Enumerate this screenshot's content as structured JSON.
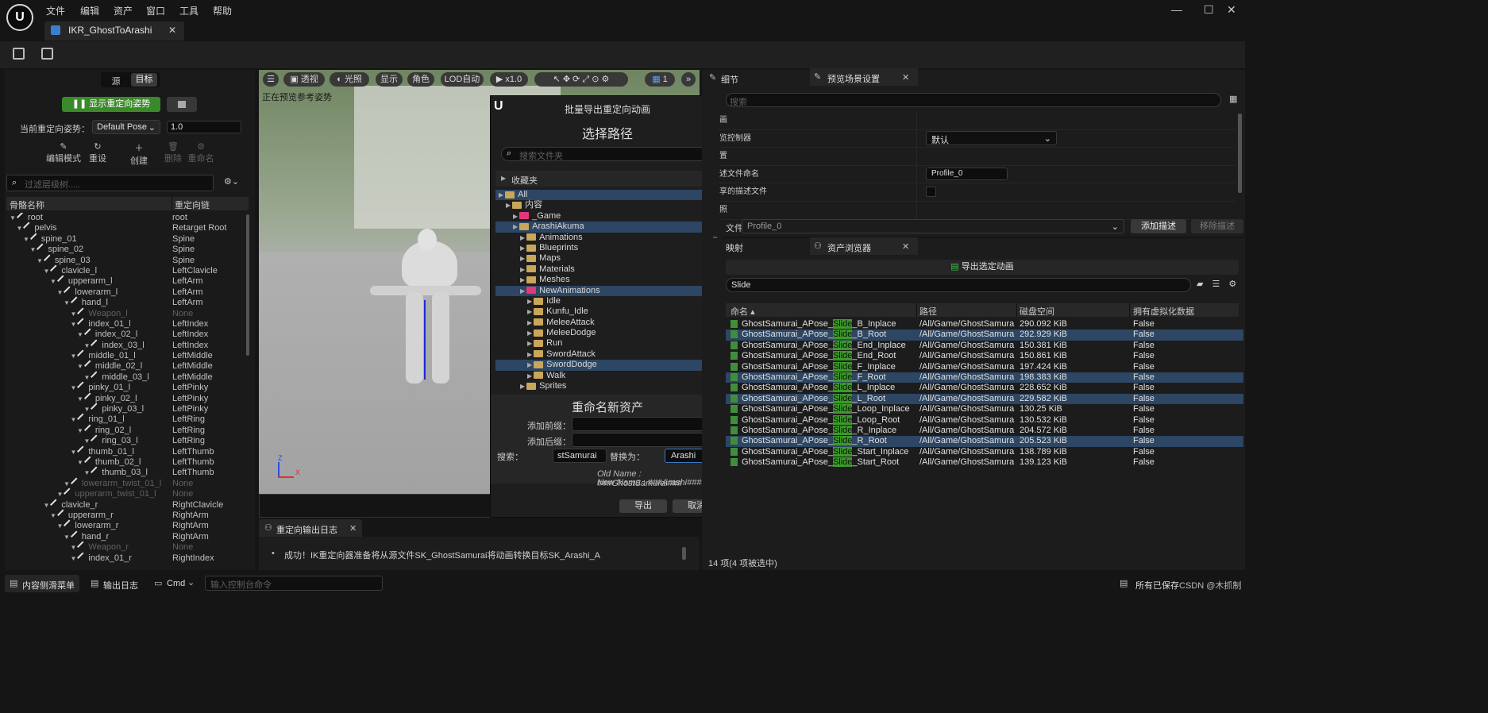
{
  "menu": [
    "文件",
    "编辑",
    "资产",
    "窗口",
    "工具",
    "帮助"
  ],
  "tab_title": "IKR_GhostToArashi",
  "left": {
    "toggle": [
      "源",
      "目标"
    ],
    "show_pose_btn": "显示重定向姿势",
    "current_pose_label": "当前重定向姿势：",
    "pose_value": "Default Pose",
    "pose_blend": "1.0",
    "tools": [
      "编辑模式",
      "重设",
      "创建",
      "删除",
      "重命名"
    ],
    "filter_placeholder": "过滤层级树.....",
    "columns": [
      "骨骼名称",
      "重定向链"
    ],
    "rows": [
      {
        "d": 0,
        "name": "root",
        "chain": "root",
        "dim": false
      },
      {
        "d": 1,
        "name": "pelvis",
        "chain": "Retarget Root",
        "dim": false
      },
      {
        "d": 2,
        "name": "spine_01",
        "chain": "Spine",
        "dim": false
      },
      {
        "d": 3,
        "name": "spine_02",
        "chain": "Spine",
        "dim": false
      },
      {
        "d": 4,
        "name": "spine_03",
        "chain": "Spine",
        "dim": false
      },
      {
        "d": 5,
        "name": "clavicle_l",
        "chain": "LeftClavicle",
        "dim": false
      },
      {
        "d": 6,
        "name": "upperarm_l",
        "chain": "LeftArm",
        "dim": false
      },
      {
        "d": 7,
        "name": "lowerarm_l",
        "chain": "LeftArm",
        "dim": false
      },
      {
        "d": 8,
        "name": "hand_l",
        "chain": "LeftArm",
        "dim": false
      },
      {
        "d": 9,
        "name": "Weapon_l",
        "chain": "None",
        "dim": true
      },
      {
        "d": 9,
        "name": "index_01_l",
        "chain": "LeftIndex",
        "dim": false
      },
      {
        "d": 10,
        "name": "index_02_l",
        "chain": "LeftIndex",
        "dim": false
      },
      {
        "d": 11,
        "name": "index_03_l",
        "chain": "LeftIndex",
        "dim": false
      },
      {
        "d": 9,
        "name": "middle_01_l",
        "chain": "LeftMiddle",
        "dim": false
      },
      {
        "d": 10,
        "name": "middle_02_l",
        "chain": "LeftMiddle",
        "dim": false
      },
      {
        "d": 11,
        "name": "middle_03_l",
        "chain": "LeftMiddle",
        "dim": false
      },
      {
        "d": 9,
        "name": "pinky_01_l",
        "chain": "LeftPinky",
        "dim": false
      },
      {
        "d": 10,
        "name": "pinky_02_l",
        "chain": "LeftPinky",
        "dim": false
      },
      {
        "d": 11,
        "name": "pinky_03_l",
        "chain": "LeftPinky",
        "dim": false
      },
      {
        "d": 9,
        "name": "ring_01_l",
        "chain": "LeftRing",
        "dim": false
      },
      {
        "d": 10,
        "name": "ring_02_l",
        "chain": "LeftRing",
        "dim": false
      },
      {
        "d": 11,
        "name": "ring_03_l",
        "chain": "LeftRing",
        "dim": false
      },
      {
        "d": 9,
        "name": "thumb_01_l",
        "chain": "LeftThumb",
        "dim": false
      },
      {
        "d": 10,
        "name": "thumb_02_l",
        "chain": "LeftThumb",
        "dim": false
      },
      {
        "d": 11,
        "name": "thumb_03_l",
        "chain": "LeftThumb",
        "dim": false
      },
      {
        "d": 8,
        "name": "lowerarm_twist_01_l",
        "chain": "None",
        "dim": true
      },
      {
        "d": 7,
        "name": "upperarm_twist_01_l",
        "chain": "None",
        "dim": true
      },
      {
        "d": 5,
        "name": "clavicle_r",
        "chain": "RightClavicle",
        "dim": false
      },
      {
        "d": 6,
        "name": "upperarm_r",
        "chain": "RightArm",
        "dim": false
      },
      {
        "d": 7,
        "name": "lowerarm_r",
        "chain": "RightArm",
        "dim": false
      },
      {
        "d": 8,
        "name": "hand_r",
        "chain": "RightArm",
        "dim": false
      },
      {
        "d": 9,
        "name": "Weapon_r",
        "chain": "None",
        "dim": true
      },
      {
        "d": 9,
        "name": "index_01_r",
        "chain": "RightIndex",
        "dim": false
      }
    ]
  },
  "viewport": {
    "buttons": [
      "透视",
      "光照",
      "显示",
      "角色",
      "LOD自动",
      "x1.0"
    ],
    "num": "1",
    "overlay": "正在预览参考姿势"
  },
  "log": {
    "tab": "重定向输出日志",
    "msg": "成功！IK重定向器准备将从源文件SK_GhostSamurai将动画转换目标SK_Arashi_A"
  },
  "dialog": {
    "title": "批量导出重定向动画",
    "heading": "选择路径",
    "search_placeholder": "搜索文件夹",
    "favorites": "收藏夹",
    "tree": [
      {
        "d": 0,
        "name": "All",
        "pink": false,
        "sel": true
      },
      {
        "d": 1,
        "name": "内容",
        "pink": false,
        "sel": false
      },
      {
        "d": 2,
        "name": "_Game",
        "pink": true,
        "sel": false
      },
      {
        "d": 2,
        "name": "ArashiAkuma",
        "pink": false,
        "sel": true
      },
      {
        "d": 3,
        "name": "Animations",
        "pink": false,
        "sel": false
      },
      {
        "d": 3,
        "name": "Blueprints",
        "pink": false,
        "sel": false
      },
      {
        "d": 3,
        "name": "Maps",
        "pink": false,
        "sel": false
      },
      {
        "d": 3,
        "name": "Materials",
        "pink": false,
        "sel": false
      },
      {
        "d": 3,
        "name": "Meshes",
        "pink": false,
        "sel": false
      },
      {
        "d": 3,
        "name": "NewAnimations",
        "pink": true,
        "sel": true
      },
      {
        "d": 4,
        "name": "Idle",
        "pink": false,
        "sel": false
      },
      {
        "d": 4,
        "name": "Kunfu_Idle",
        "pink": false,
        "sel": false
      },
      {
        "d": 4,
        "name": "MeleeAttack",
        "pink": false,
        "sel": false
      },
      {
        "d": 4,
        "name": "MeleeDodge",
        "pink": false,
        "sel": false
      },
      {
        "d": 4,
        "name": "Run",
        "pink": false,
        "sel": false
      },
      {
        "d": 4,
        "name": "SwordAttack",
        "pink": false,
        "sel": false
      },
      {
        "d": 4,
        "name": "SwordDodge",
        "pink": false,
        "sel": true
      },
      {
        "d": 4,
        "name": "Walk",
        "pink": false,
        "sel": false
      },
      {
        "d": 3,
        "name": "Sprites",
        "pink": false,
        "sel": false
      }
    ],
    "rename_heading": "重命名新资产",
    "prefix_label": "添加前缀：",
    "suffix_label": "添加后缀：",
    "search_label": "搜索：",
    "search_value": "stSamurai",
    "replace_label": "替换为：",
    "replace_value": "Arashi",
    "old_name": "Old Name : ###GhostSamurai###",
    "new_name": "New Name : ###Arashi###",
    "export": "导出",
    "cancel": "取消"
  },
  "details": {
    "tab1": "细节",
    "tab2": "预览场景设置",
    "search_placeholder": "搜索",
    "rows": [
      "画",
      "览控制器",
      "置",
      "述文件命名",
      "享的描述文件",
      "照"
    ],
    "controller_value": "默认",
    "profile_name": "Profile_0",
    "profile_label": "文件",
    "profile_select": "Profile_0",
    "add_btn": "添加描述",
    "remove_btn": "移除描述"
  },
  "assets": {
    "tab1": "映射",
    "tab2": "资产浏览器",
    "export_btn": "导出选定动画",
    "search_value": "Slide",
    "columns": [
      "命名",
      "路径",
      "磁盘空间",
      "拥有虚拟化数据"
    ],
    "rows": [
      {
        "pre": "GhostSamurai_APose_",
        "hl": "Slide",
        "post": "_B_Inplace",
        "path": "/All/Game/GhostSamura",
        "size": "290.092 KiB",
        "virt": "False",
        "sel": false
      },
      {
        "pre": "GhostSamurai_APose_",
        "hl": "Slide",
        "post": "_B_Root",
        "path": "/All/Game/GhostSamura",
        "size": "292.929 KiB",
        "virt": "False",
        "sel": true
      },
      {
        "pre": "GhostSamurai_APose_",
        "hl": "Slide",
        "post": "_End_Inplace",
        "path": "/All/Game/GhostSamura",
        "size": "150.381 KiB",
        "virt": "False",
        "sel": false
      },
      {
        "pre": "GhostSamurai_APose_",
        "hl": "Slide",
        "post": "_End_Root",
        "path": "/All/Game/GhostSamura",
        "size": "150.861 KiB",
        "virt": "False",
        "sel": false
      },
      {
        "pre": "GhostSamurai_APose_",
        "hl": "Slide",
        "post": "_F_Inplace",
        "path": "/All/Game/GhostSamura",
        "size": "197.424 KiB",
        "virt": "False",
        "sel": false
      },
      {
        "pre": "GhostSamurai_APose_",
        "hl": "Slide",
        "post": "_F_Root",
        "path": "/All/Game/GhostSamura",
        "size": "198.383 KiB",
        "virt": "False",
        "sel": true
      },
      {
        "pre": "GhostSamurai_APose_",
        "hl": "Slide",
        "post": "_L_Inplace",
        "path": "/All/Game/GhostSamura",
        "size": "228.652 KiB",
        "virt": "False",
        "sel": false
      },
      {
        "pre": "GhostSamurai_APose_",
        "hl": "Slide",
        "post": "_L_Root",
        "path": "/All/Game/GhostSamura",
        "size": "229.582 KiB",
        "virt": "False",
        "sel": true
      },
      {
        "pre": "GhostSamurai_APose_",
        "hl": "Slide",
        "post": "_Loop_Inplace",
        "path": "/All/Game/GhostSamura",
        "size": "130.25 KiB",
        "virt": "False",
        "sel": false
      },
      {
        "pre": "GhostSamurai_APose_",
        "hl": "Slide",
        "post": "_Loop_Root",
        "path": "/All/Game/GhostSamura",
        "size": "130.532 KiB",
        "virt": "False",
        "sel": false
      },
      {
        "pre": "GhostSamurai_APose_",
        "hl": "Slide",
        "post": "_R_Inplace",
        "path": "/All/Game/GhostSamura",
        "size": "204.572 KiB",
        "virt": "False",
        "sel": false
      },
      {
        "pre": "GhostSamurai_APose_",
        "hl": "Slide",
        "post": "_R_Root",
        "path": "/All/Game/GhostSamura",
        "size": "205.523 KiB",
        "virt": "False",
        "sel": true
      },
      {
        "pre": "GhostSamurai_APose_",
        "hl": "Slide",
        "post": "_Start_Inplace",
        "path": "/All/Game/GhostSamura",
        "size": "138.789 KiB",
        "virt": "False",
        "sel": false
      },
      {
        "pre": "GhostSamurai_APose_",
        "hl": "Slide",
        "post": "_Start_Root",
        "path": "/All/Game/GhostSamura",
        "size": "139.123 KiB",
        "virt": "False",
        "sel": false
      }
    ],
    "count": "14 项(4 项被选中)"
  },
  "status": {
    "drawer": "内容侧滑菜单",
    "log": "输出日志",
    "cmd": "Cmd",
    "console_placeholder": "输入控制台命令",
    "saved": "所有已保存",
    "watermark": "CSDN @木抓制"
  }
}
